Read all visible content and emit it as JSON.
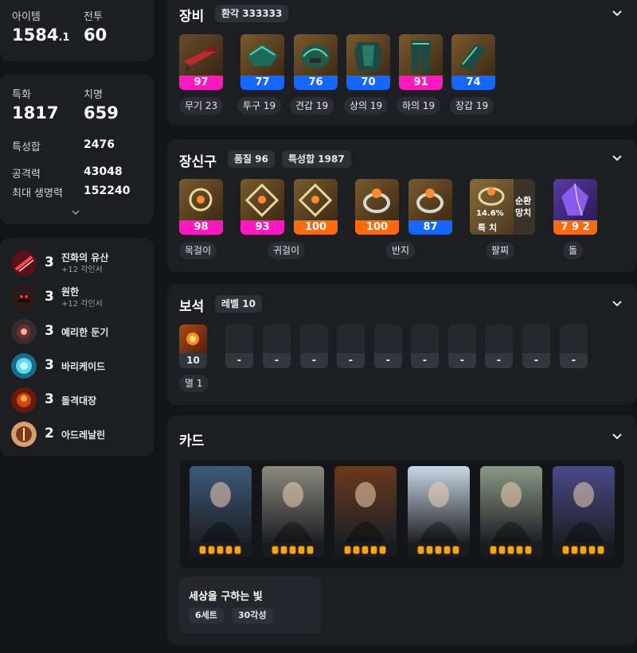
{
  "stats_top": {
    "item_level_label": "아이템",
    "item_level_value": "1584",
    "item_level_decimal": ".1",
    "combat_label": "전투",
    "combat_value": "60"
  },
  "stats_main": {
    "spec_label": "특화",
    "spec_value": "1817",
    "crit_label": "치명",
    "crit_value": "659",
    "total_label": "특성합",
    "total_value": "2476",
    "attack_label": "공격력",
    "attack_value": "43048",
    "hp_label": "최대 생명력",
    "hp_value": "152240"
  },
  "engravings": [
    {
      "level": "3",
      "name": "진화의 유산",
      "sub": "+12 각인서",
      "icon": "engraving-evolution-icon"
    },
    {
      "level": "3",
      "name": "원한",
      "sub": "+12 각인서",
      "icon": "engraving-grudge-icon"
    },
    {
      "level": "3",
      "name": "예리한 둔기",
      "sub": "",
      "icon": "engraving-keen-blunt-icon"
    },
    {
      "level": "3",
      "name": "바리케이드",
      "sub": "",
      "icon": "engraving-barricade-icon"
    },
    {
      "level": "3",
      "name": "돌격대장",
      "sub": "",
      "icon": "engraving-raid-captain-icon"
    },
    {
      "level": "2",
      "name": "아드레날린",
      "sub": "",
      "icon": "engraving-adrenaline-icon"
    }
  ],
  "equipment": {
    "title": "장비",
    "badge": "환각 333333",
    "items": [
      {
        "quality": "97",
        "label": "무기 23",
        "grade_color": "pink",
        "icon": "weapon-icon"
      },
      {
        "quality": "77",
        "label": "투구 19",
        "grade_color": "blue",
        "icon": "helmet-icon"
      },
      {
        "quality": "76",
        "label": "견갑 19",
        "grade_color": "blue",
        "icon": "shoulder-icon"
      },
      {
        "quality": "70",
        "label": "상의 19",
        "grade_color": "blue",
        "icon": "chest-armor-icon"
      },
      {
        "quality": "91",
        "label": "하의 19",
        "grade_color": "pink",
        "icon": "pants-icon"
      },
      {
        "quality": "74",
        "label": "장갑 19",
        "grade_color": "blue",
        "icon": "gloves-icon"
      }
    ]
  },
  "accessories": {
    "title": "장신구",
    "quality_badge": "품질 96",
    "stat_badge": "특성합 1987",
    "necklace": {
      "quality": "98",
      "label": "목걸이"
    },
    "earrings": [
      {
        "quality": "93"
      },
      {
        "quality": "100"
      }
    ],
    "earring_label": "귀걸이",
    "rings": [
      {
        "quality": "100"
      },
      {
        "quality": "87"
      }
    ],
    "ring_label": "반지",
    "bracelet": {
      "percent": "14.6%",
      "stat": "특 치",
      "effect": "순환\n망치",
      "label": "팔찌"
    },
    "stone": {
      "value": "7 9 2",
      "label": "돌"
    }
  },
  "gems": {
    "title": "보석",
    "level_badge": "레벨 10",
    "filled": {
      "level": "10",
      "label": "멸 1"
    },
    "empty_slots": [
      "-",
      "-",
      "-",
      "-",
      "-",
      "-",
      "-",
      "-",
      "-",
      "-"
    ]
  },
  "cards": {
    "title": "카드",
    "awakening_per_card": 5,
    "items": [
      {
        "name": "card-1",
        "bg": "#3c5a7a"
      },
      {
        "name": "card-2",
        "bg": "#8a8a7e"
      },
      {
        "name": "card-3",
        "bg": "#6a3a1e"
      },
      {
        "name": "card-4",
        "bg": "#c9d8e6"
      },
      {
        "name": "card-5",
        "bg": "#8a9a86"
      },
      {
        "name": "card-6",
        "bg": "#4a4a8a"
      }
    ],
    "set_name": "세상을 구하는 빛",
    "set_count": "6세트",
    "set_awaken": "30각성"
  },
  "colors": {
    "pink": "#ff17c0",
    "blue": "#1466ff",
    "orange": "#ff6a0e",
    "panel": "#1c1e22",
    "background": "#131417"
  }
}
